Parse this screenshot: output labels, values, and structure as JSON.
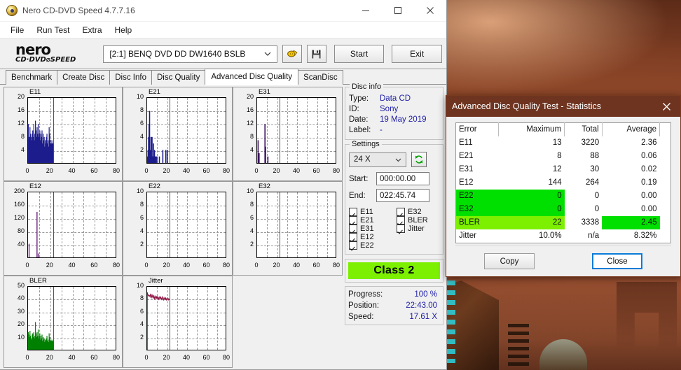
{
  "window": {
    "title": "Nero CD-DVD Speed 4.7.7.16",
    "app_icon": "nero-disc-icon",
    "minimize": "–",
    "maximize": "□",
    "close": "✕"
  },
  "menubar": {
    "items": [
      "File",
      "Run Test",
      "Extra",
      "Help"
    ]
  },
  "toolbar": {
    "logo_line1": "nero",
    "logo_line2": "CD·DVD⌀SPEED",
    "drive": "[2:1]   BENQ DVD DD DW1640 BSLB",
    "eject_icon": "eject-disc-icon",
    "save_icon": "floppy-save-icon",
    "start_label": "Start",
    "exit_label": "Exit",
    "chevron": "⌄"
  },
  "tabs": [
    {
      "label": "Benchmark",
      "active": false
    },
    {
      "label": "Create Disc",
      "active": false
    },
    {
      "label": "Disc Info",
      "active": false
    },
    {
      "label": "Disc Quality",
      "active": false
    },
    {
      "label": "Advanced Disc Quality",
      "active": true
    },
    {
      "label": "ScanDisc",
      "active": false
    }
  ],
  "disc_info": {
    "legend": "Disc info",
    "rows": [
      {
        "key": "Type:",
        "value": "Data CD"
      },
      {
        "key": "ID:",
        "value": "Sony"
      },
      {
        "key": "Date:",
        "value": "19 May 2019"
      },
      {
        "key": "Label:",
        "value": "-"
      }
    ]
  },
  "settings": {
    "legend": "Settings",
    "speed": "24 X",
    "refresh_icon": "refresh-arrows-icon",
    "start_label": "Start:",
    "start_value": "000:00.00",
    "end_label": "End:",
    "end_value": "022:45.74",
    "checkboxes": [
      {
        "label": "E11",
        "checked": true
      },
      {
        "label": "E32",
        "checked": true
      },
      {
        "label": "E21",
        "checked": true
      },
      {
        "label": "BLER",
        "checked": true
      },
      {
        "label": "E31",
        "checked": true
      },
      {
        "label": "Jitter",
        "checked": true
      },
      {
        "label": "E12",
        "checked": true
      },
      {
        "label": "",
        "checked": false
      },
      {
        "label": "E22",
        "checked": true
      },
      {
        "label": "",
        "checked": false
      }
    ]
  },
  "class_badge": {
    "label": "Class 2",
    "color": "#7cf000"
  },
  "status": [
    {
      "key": "Progress:",
      "value": "100 %"
    },
    {
      "key": "Position:",
      "value": "22:43.00"
    },
    {
      "key": "Speed:",
      "value": "17.61 X"
    }
  ],
  "stats_dialog": {
    "title": "Advanced Disc Quality Test - Statistics",
    "close_icon": "close-icon",
    "title_bg": "#6e3420",
    "highlight_green": "#00e000",
    "highlight_yellowgreen": "#7cf000",
    "columns": [
      "Error",
      "Maximum",
      "Total",
      "Average"
    ],
    "rows": [
      {
        "error": "E11",
        "maximum": "13",
        "total": "3220",
        "average": "2.36",
        "hl": "none"
      },
      {
        "error": "E21",
        "maximum": "8",
        "total": "88",
        "average": "0.06",
        "hl": "none"
      },
      {
        "error": "E31",
        "maximum": "12",
        "total": "30",
        "average": "0.02",
        "hl": "none"
      },
      {
        "error": "E12",
        "maximum": "144",
        "total": "264",
        "average": "0.19",
        "hl": "none"
      },
      {
        "error": "E22",
        "maximum": "0",
        "total": "0",
        "average": "0.00",
        "hl": "green-left"
      },
      {
        "error": "E32",
        "maximum": "0",
        "total": "0",
        "average": "0.00",
        "hl": "green-left"
      },
      {
        "error": "BLER",
        "maximum": "22",
        "total": "3338",
        "average": "2.45",
        "hl": "bler"
      },
      {
        "error": "Jitter",
        "maximum": "10.0%",
        "total": "n/a",
        "average": "8.32%",
        "hl": "none"
      }
    ],
    "copy_label": "Copy",
    "close_label": "Close"
  },
  "chart_data": [
    {
      "type": "bar",
      "title": "E11",
      "color": "#1c1c8c",
      "xlabel": "",
      "ylabel": "",
      "xlim": [
        0,
        80
      ],
      "ylim": [
        0,
        20
      ],
      "xticks": [
        0,
        20,
        40,
        60,
        80
      ],
      "yticks": [
        4,
        8,
        12,
        16,
        20
      ],
      "grid": true,
      "marker_x": 22.8,
      "x": [
        0.3,
        0.8,
        1.3,
        1.8,
        2.3,
        2.8,
        3.3,
        3.8,
        4.3,
        4.8,
        5.3,
        5.8,
        6.3,
        6.8,
        7.3,
        7.8,
        8.3,
        8.8,
        9.3,
        9.8,
        10.3,
        10.8,
        11.3,
        11.8,
        12.3,
        12.8,
        13.3,
        13.8,
        14.3,
        14.8,
        15.3,
        15.8,
        16.3,
        16.8,
        17.3,
        17.8,
        18.3,
        18.8,
        19.3,
        19.8,
        20.3,
        20.8,
        21.3,
        21.8,
        22.3,
        22.8
      ],
      "values": [
        12,
        8,
        8,
        11,
        9,
        8,
        7,
        9,
        10,
        8,
        12,
        7,
        9,
        13,
        10,
        8,
        11,
        9,
        12,
        8,
        9,
        10,
        7,
        9,
        8,
        10,
        6,
        9,
        7,
        8,
        5,
        7,
        6,
        8,
        9,
        6,
        7,
        5,
        11,
        9,
        7,
        6,
        6,
        7,
        6,
        6
      ]
    },
    {
      "type": "bar",
      "title": "E21",
      "color": "#1c1c8c",
      "xlabel": "",
      "ylabel": "",
      "xlim": [
        0,
        80
      ],
      "ylim": [
        0,
        10
      ],
      "xticks": [
        0,
        20,
        40,
        60,
        80
      ],
      "yticks": [
        2,
        4,
        6,
        8,
        10
      ],
      "grid": true,
      "marker_x": 22.8,
      "x": [
        0.5,
        1.0,
        1.5,
        2.0,
        2.5,
        3.0,
        3.5,
        4.0,
        4.5,
        5.0,
        5.5,
        6.0,
        6.5,
        7.0,
        7.5,
        8.0,
        9.0,
        10.0,
        11.0,
        12.5,
        14.0,
        16.0,
        17.5,
        19.0,
        20.5
      ],
      "values": [
        1,
        2,
        4,
        6,
        8,
        2,
        1,
        4,
        1,
        4,
        1,
        1,
        3,
        1,
        2,
        1,
        1,
        1,
        0,
        1,
        0,
        2,
        0,
        2,
        2
      ]
    },
    {
      "type": "bar",
      "title": "E31",
      "color": "#3b1060",
      "xlabel": "",
      "ylabel": "",
      "xlim": [
        0,
        80
      ],
      "ylim": [
        0,
        20
      ],
      "xticks": [
        0,
        20,
        40,
        60,
        80
      ],
      "yticks": [
        4,
        8,
        12,
        16,
        20
      ],
      "grid": true,
      "marker_x": 22.8,
      "x": [
        1.0,
        2.0,
        8.0,
        8.6,
        11.0
      ],
      "values": [
        7,
        3,
        12,
        5,
        2
      ]
    },
    {
      "type": "bar",
      "title": "E12",
      "color": "#7a3a8c",
      "xlabel": "",
      "ylabel": "",
      "xlim": [
        0,
        80
      ],
      "ylim": [
        0,
        200
      ],
      "xticks": [
        0,
        20,
        40,
        60,
        80
      ],
      "yticks": [
        40,
        80,
        120,
        160,
        200
      ],
      "grid": true,
      "marker_x": 22.8,
      "x": [
        1.0,
        8.2,
        9.4
      ],
      "values": [
        42,
        140,
        12
      ]
    },
    {
      "type": "bar",
      "title": "E22",
      "color": "#1c1c8c",
      "xlabel": "",
      "ylabel": "",
      "xlim": [
        0,
        80
      ],
      "ylim": [
        0,
        10
      ],
      "xticks": [
        0,
        20,
        40,
        60,
        80
      ],
      "yticks": [
        2,
        4,
        6,
        8,
        10
      ],
      "grid": true,
      "marker_x": 22.8,
      "x": [],
      "values": []
    },
    {
      "type": "bar",
      "title": "E32",
      "color": "#1c1c8c",
      "xlabel": "",
      "ylabel": "",
      "xlim": [
        0,
        80
      ],
      "ylim": [
        0,
        10
      ],
      "xticks": [
        0,
        20,
        40,
        60,
        80
      ],
      "yticks": [
        2,
        4,
        6,
        8,
        10
      ],
      "grid": true,
      "marker_x": 22.8,
      "x": [],
      "values": []
    },
    {
      "type": "bar",
      "title": "BLER",
      "color": "#008000",
      "xlabel": "",
      "ylabel": "",
      "xlim": [
        0,
        80
      ],
      "ylim": [
        0,
        50
      ],
      "xticks": [
        0,
        20,
        40,
        60,
        80
      ],
      "yticks": [
        10,
        20,
        30,
        40,
        50
      ],
      "grid": true,
      "marker_x": 22.8,
      "x": [
        0.3,
        0.8,
        1.3,
        1.8,
        2.3,
        2.8,
        3.3,
        3.8,
        4.3,
        4.8,
        5.3,
        5.8,
        6.3,
        6.8,
        7.3,
        7.8,
        8.3,
        8.8,
        9.3,
        9.8,
        10.3,
        10.8,
        11.3,
        11.8,
        12.3,
        12.8,
        13.3,
        13.8,
        14.3,
        14.8,
        15.3,
        15.8,
        16.3,
        16.8,
        17.3,
        17.8,
        18.3,
        18.8,
        19.3,
        19.8,
        20.3,
        20.8,
        21.3,
        21.8,
        22.3,
        22.8
      ],
      "values": [
        14,
        12,
        10,
        15,
        11,
        9,
        8,
        12,
        13,
        10,
        14,
        9,
        11,
        22,
        13,
        10,
        14,
        11,
        16,
        9,
        11,
        13,
        8,
        11,
        9,
        12,
        7,
        10,
        8,
        9,
        6,
        8,
        7,
        9,
        11,
        7,
        8,
        6,
        13,
        10,
        8,
        7,
        7,
        8,
        7,
        7
      ]
    },
    {
      "type": "line",
      "title": "Jitter",
      "color": "#8c1040",
      "xlabel": "",
      "ylabel": "",
      "xlim": [
        0,
        80
      ],
      "ylim": [
        0,
        10
      ],
      "xticks": [
        0,
        20,
        40,
        60,
        80
      ],
      "yticks": [
        2,
        4,
        6,
        8,
        10
      ],
      "grid": true,
      "marker_x": 22.8,
      "x": [
        0.2,
        0.6,
        1.0,
        1.5,
        2.0,
        2.5,
        3.0,
        3.5,
        4.0,
        4.5,
        5.0,
        5.5,
        6.0,
        6.5,
        7.0,
        7.5,
        8.0,
        8.5,
        9.0,
        9.5,
        10.0,
        10.5,
        11.0,
        11.5,
        12.0,
        12.5,
        13.0,
        13.5,
        14.0,
        14.5,
        15.0,
        15.5,
        16.0,
        16.5,
        17.0,
        17.5,
        18.0,
        18.5,
        19.0,
        19.5,
        20.0,
        20.5,
        21.0,
        21.5,
        22.0,
        22.5,
        22.8
      ],
      "values": [
        9.1,
        8.8,
        8.6,
        8.7,
        8.5,
        8.6,
        8.4,
        8.9,
        8.5,
        8.3,
        8.8,
        8.4,
        8.2,
        8.7,
        8.3,
        8.1,
        8.6,
        8.3,
        8.0,
        8.5,
        8.2,
        8.4,
        8.1,
        8.3,
        8.0,
        8.2,
        8.5,
        8.1,
        8.3,
        8.0,
        8.2,
        8.4,
        8.0,
        8.2,
        7.9,
        8.1,
        8.3,
        8.0,
        8.2,
        7.9,
        8.1,
        8.0,
        8.2,
        7.9,
        8.1,
        8.0,
        8.1
      ]
    }
  ]
}
